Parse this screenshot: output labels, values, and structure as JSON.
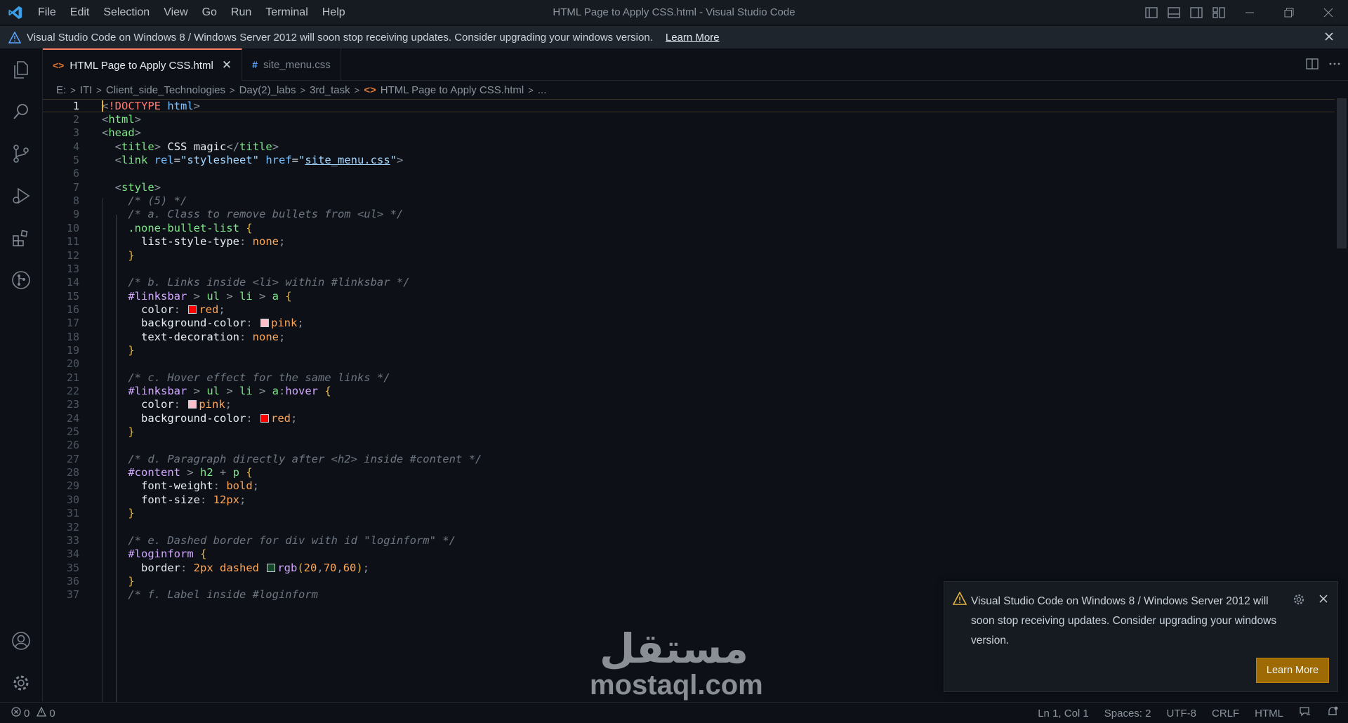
{
  "menu": [
    "File",
    "Edit",
    "Selection",
    "View",
    "Go",
    "Run",
    "Terminal",
    "Help"
  ],
  "window_title": "HTML Page to Apply CSS.html - Visual Studio Code",
  "banner": {
    "message": "Visual Studio Code on Windows 8 / Windows Server 2012 will soon stop receiving updates. Consider upgrading your windows version.",
    "link": "Learn More"
  },
  "activity_icons": [
    "explorer-icon",
    "search-icon",
    "source-control-icon",
    "run-debug-icon",
    "extensions-icon",
    "git-graph-icon",
    "account-icon",
    "settings-gear-icon"
  ],
  "tabs": [
    {
      "label": "HTML Page to Apply CSS.html",
      "icon": "<>",
      "active": true
    },
    {
      "label": "site_menu.css",
      "icon": "#",
      "active": false
    }
  ],
  "breadcrumb": [
    "E:",
    "ITI",
    "Client_side_Technologies",
    "Day(2)_labs",
    "3rd_task",
    "HTML Page to Apply CSS.html",
    "..."
  ],
  "breadcrumb_file_icon": "<>",
  "code_lines": [
    [
      [
        "t-br",
        "<"
      ],
      [
        "t-kw",
        "!DOCTYPE"
      ],
      [
        "t-attr",
        " html"
      ],
      [
        "t-br",
        ">"
      ]
    ],
    [
      [
        "t-br",
        "<"
      ],
      [
        "t-tag",
        "html"
      ],
      [
        "t-br",
        ">"
      ]
    ],
    [
      [
        "t-br",
        "<"
      ],
      [
        "t-tag",
        "head"
      ],
      [
        "t-br",
        ">"
      ]
    ],
    [
      [
        "t-txt",
        "  "
      ],
      [
        "t-br",
        "<"
      ],
      [
        "t-tag",
        "title"
      ],
      [
        "t-br",
        ">"
      ],
      [
        "t-txt",
        " CSS magic"
      ],
      [
        "t-br",
        "</"
      ],
      [
        "t-tag",
        "title"
      ],
      [
        "t-br",
        ">"
      ]
    ],
    [
      [
        "t-txt",
        "  "
      ],
      [
        "t-br",
        "<"
      ],
      [
        "t-tag",
        "link"
      ],
      [
        "t-attr",
        " rel"
      ],
      [
        "t-txt",
        "="
      ],
      [
        "t-str",
        "\"stylesheet\""
      ],
      [
        "t-attr",
        " href"
      ],
      [
        "t-txt",
        "="
      ],
      [
        "t-str",
        "\""
      ],
      [
        "t-link",
        "site_menu.css"
      ],
      [
        "t-str",
        "\""
      ],
      [
        "t-br",
        ">"
      ]
    ],
    [],
    [
      [
        "t-txt",
        "  "
      ],
      [
        "t-br",
        "<"
      ],
      [
        "t-tag",
        "style"
      ],
      [
        "t-br",
        ">"
      ]
    ],
    [
      [
        "t-txt",
        "    "
      ],
      [
        "t-cmt",
        "/* (5) */"
      ]
    ],
    [
      [
        "t-txt",
        "    "
      ],
      [
        "t-cmt",
        "/* a. Class to remove bullets from <ul> */"
      ]
    ],
    [
      [
        "t-txt",
        "    "
      ],
      [
        "t-cls",
        ".none-bullet-list"
      ],
      [
        "t-brace",
        " {"
      ]
    ],
    [
      [
        "t-txt",
        "      "
      ],
      [
        "t-prop",
        "list-style-type"
      ],
      [
        "t-pc",
        ": "
      ],
      [
        "t-val",
        "none"
      ],
      [
        "t-pc",
        ";"
      ]
    ],
    [
      [
        "t-txt",
        "    "
      ],
      [
        "t-brace",
        "}"
      ]
    ],
    [],
    [
      [
        "t-txt",
        "    "
      ],
      [
        "t-cmt",
        "/* b. Links inside <li> within #linksbar */"
      ]
    ],
    [
      [
        "t-txt",
        "    "
      ],
      [
        "t-id",
        "#linksbar"
      ],
      [
        "t-pc",
        " > "
      ],
      [
        "t-tag",
        "ul"
      ],
      [
        "t-pc",
        " > "
      ],
      [
        "t-tag",
        "li"
      ],
      [
        "t-pc",
        " > "
      ],
      [
        "t-tag",
        "a"
      ],
      [
        "t-brace",
        " {"
      ]
    ],
    [
      [
        "t-txt",
        "      "
      ],
      [
        "t-prop",
        "color"
      ],
      [
        "t-pc",
        ": "
      ],
      [
        "swatch",
        "#ff0000"
      ],
      [
        "t-val",
        "red"
      ],
      [
        "t-pc",
        ";"
      ]
    ],
    [
      [
        "t-txt",
        "      "
      ],
      [
        "t-prop",
        "background-color"
      ],
      [
        "t-pc",
        ": "
      ],
      [
        "swatch",
        "#ffc0cb"
      ],
      [
        "t-val",
        "pink"
      ],
      [
        "t-pc",
        ";"
      ]
    ],
    [
      [
        "t-txt",
        "      "
      ],
      [
        "t-prop",
        "text-decoration"
      ],
      [
        "t-pc",
        ": "
      ],
      [
        "t-val",
        "none"
      ],
      [
        "t-pc",
        ";"
      ]
    ],
    [
      [
        "t-txt",
        "    "
      ],
      [
        "t-brace",
        "}"
      ]
    ],
    [],
    [
      [
        "t-txt",
        "    "
      ],
      [
        "t-cmt",
        "/* c. Hover effect for the same links */"
      ]
    ],
    [
      [
        "t-txt",
        "    "
      ],
      [
        "t-id",
        "#linksbar"
      ],
      [
        "t-pc",
        " > "
      ],
      [
        "t-tag",
        "ul"
      ],
      [
        "t-pc",
        " > "
      ],
      [
        "t-tag",
        "li"
      ],
      [
        "t-pc",
        " > "
      ],
      [
        "t-tag",
        "a"
      ],
      [
        "t-pc",
        ":"
      ],
      [
        "t-id",
        "hover"
      ],
      [
        "t-brace",
        " {"
      ]
    ],
    [
      [
        "t-txt",
        "      "
      ],
      [
        "t-prop",
        "color"
      ],
      [
        "t-pc",
        ": "
      ],
      [
        "swatch",
        "#ffc0cb"
      ],
      [
        "t-val",
        "pink"
      ],
      [
        "t-pc",
        ";"
      ]
    ],
    [
      [
        "t-txt",
        "      "
      ],
      [
        "t-prop",
        "background-color"
      ],
      [
        "t-pc",
        ": "
      ],
      [
        "swatch",
        "#ff0000"
      ],
      [
        "t-val",
        "red"
      ],
      [
        "t-pc",
        ";"
      ]
    ],
    [
      [
        "t-txt",
        "    "
      ],
      [
        "t-brace",
        "}"
      ]
    ],
    [],
    [
      [
        "t-txt",
        "    "
      ],
      [
        "t-cmt",
        "/* d. Paragraph directly after <h2> inside #content */"
      ]
    ],
    [
      [
        "t-txt",
        "    "
      ],
      [
        "t-id",
        "#content"
      ],
      [
        "t-pc",
        " > "
      ],
      [
        "t-tag",
        "h2"
      ],
      [
        "t-pc",
        " + "
      ],
      [
        "t-tag",
        "p"
      ],
      [
        "t-brace",
        " {"
      ]
    ],
    [
      [
        "t-txt",
        "      "
      ],
      [
        "t-prop",
        "font-weight"
      ],
      [
        "t-pc",
        ": "
      ],
      [
        "t-val",
        "bold"
      ],
      [
        "t-pc",
        ";"
      ]
    ],
    [
      [
        "t-txt",
        "      "
      ],
      [
        "t-prop",
        "font-size"
      ],
      [
        "t-pc",
        ": "
      ],
      [
        "t-num",
        "12px"
      ],
      [
        "t-pc",
        ";"
      ]
    ],
    [
      [
        "t-txt",
        "    "
      ],
      [
        "t-brace",
        "}"
      ]
    ],
    [],
    [
      [
        "t-txt",
        "    "
      ],
      [
        "t-cmt",
        "/* e. Dashed border for div with id \"loginform\" */"
      ]
    ],
    [
      [
        "t-txt",
        "    "
      ],
      [
        "t-id",
        "#loginform"
      ],
      [
        "t-brace",
        " {"
      ]
    ],
    [
      [
        "t-txt",
        "      "
      ],
      [
        "t-prop",
        "border"
      ],
      [
        "t-pc",
        ": "
      ],
      [
        "t-num",
        "2px"
      ],
      [
        "t-val",
        " dashed "
      ],
      [
        "swatch",
        "#144628"
      ],
      [
        "t-fn",
        "rgb"
      ],
      [
        "t-brace",
        "("
      ],
      [
        "t-num",
        "20"
      ],
      [
        "t-pc",
        ","
      ],
      [
        "t-num",
        "70"
      ],
      [
        "t-pc",
        ","
      ],
      [
        "t-num",
        "60"
      ],
      [
        "t-brace",
        ")"
      ],
      [
        "t-pc",
        ";"
      ]
    ],
    [
      [
        "t-txt",
        "    "
      ],
      [
        "t-brace",
        "}"
      ]
    ],
    [
      [
        "t-txt",
        "    "
      ],
      [
        "t-cmt",
        "/* f. Label inside #loginform"
      ]
    ]
  ],
  "notification": {
    "message": "Visual Studio Code on Windows 8 / Windows Server 2012 will soon stop receiving updates. Consider upgrading your windows version.",
    "button": "Learn More"
  },
  "watermark": {
    "arabic": "مستقل",
    "latin": "mostaql.com"
  },
  "status": {
    "errors": "0",
    "warnings": "0",
    "position": "Ln 1, Col 1",
    "spaces": "Spaces: 2",
    "encoding": "UTF-8",
    "eol": "CRLF",
    "language": "HTML"
  },
  "colors": {
    "accent": "#f78166",
    "button": "#9e6a03",
    "warning": "#e3b341",
    "html_icon": "#e37933"
  }
}
